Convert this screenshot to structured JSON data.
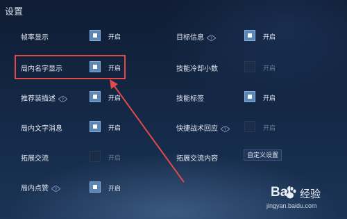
{
  "title": "设置",
  "colors": {
    "accent": "#5b86b8",
    "highlight": "#e24a4a",
    "background": "#132744"
  },
  "settings_left": [
    {
      "label": "帧率显示",
      "help": false,
      "checked": true,
      "option": "开启"
    },
    {
      "label": "局内名字显示",
      "help": false,
      "checked": true,
      "option": "开启"
    },
    {
      "label": "推荐装描述",
      "help": true,
      "checked": true,
      "option": "开启"
    },
    {
      "label": "局内文字消息",
      "help": false,
      "checked": true,
      "option": "开启"
    },
    {
      "label": "拓展交流",
      "help": false,
      "checked": false,
      "option": "开启"
    },
    {
      "label": "局内点赞",
      "help": true,
      "checked": true,
      "option": "开启"
    }
  ],
  "settings_right": [
    {
      "label": "目标信息",
      "help": true,
      "checked": true,
      "option": "开启"
    },
    {
      "label": "技能冷却小数",
      "help": false,
      "checked": false,
      "option": "开启"
    },
    {
      "label": "技能标签",
      "help": false,
      "checked": true,
      "option": "开启"
    },
    {
      "label": "快捷战术回应",
      "help": true,
      "checked": false,
      "option": "开启"
    },
    {
      "label": "拓展交流内容",
      "help": false,
      "dropdown": "自定义设置"
    }
  ],
  "watermark": {
    "brand": "Bai",
    "brand_suffix": "经验",
    "url": "jingyan.baidu.com"
  }
}
